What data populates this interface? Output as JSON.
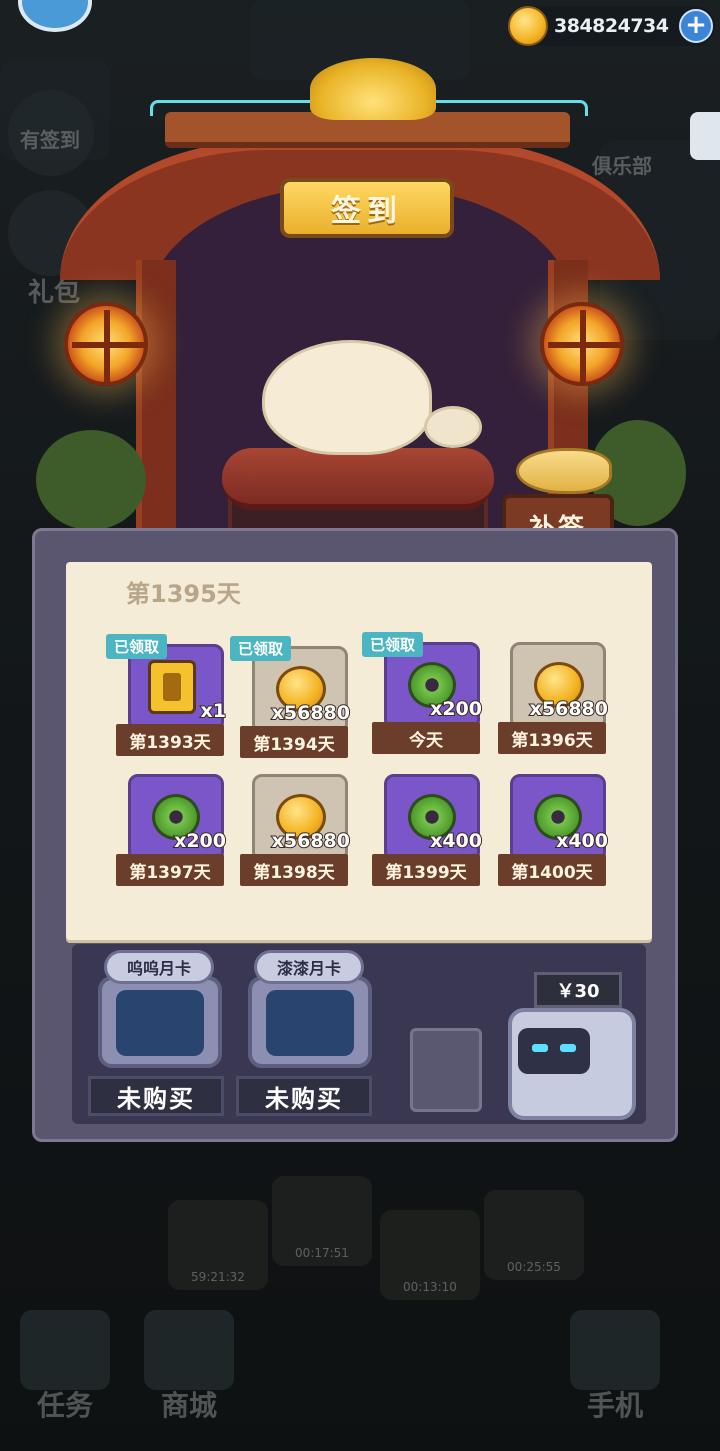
{
  "top_bar": {
    "coins": "384824734",
    "plus_symbol": "+"
  },
  "background": {
    "left_labels": [
      "有签到",
      "礼包"
    ],
    "right_label": "俱乐部"
  },
  "shrine": {
    "sign": "签到",
    "makeup_button": "补签"
  },
  "checkin": {
    "current_day": "第1395天",
    "claimed_label": "已领取",
    "rewards": [
      {
        "day": "第1393天",
        "item": "battery-icon",
        "qty": "x1",
        "claimed": true,
        "bg": "purple"
      },
      {
        "day": "第1394天",
        "item": "coin-icon",
        "qty": "x56880",
        "claimed": true,
        "bg": "paper"
      },
      {
        "day": "今天",
        "item": "donut-icon",
        "qty": "x200",
        "claimed": true,
        "bg": "purple"
      },
      {
        "day": "第1396天",
        "item": "coin-icon",
        "qty": "x56880",
        "claimed": false,
        "bg": "paper"
      },
      {
        "day": "第1397天",
        "item": "donut-icon",
        "qty": "x200",
        "claimed": false,
        "bg": "purple"
      },
      {
        "day": "第1398天",
        "item": "coin-icon",
        "qty": "x56880",
        "claimed": false,
        "bg": "paper"
      },
      {
        "day": "第1399天",
        "item": "donut-icon",
        "qty": "x400",
        "claimed": false,
        "bg": "purple"
      },
      {
        "day": "第1400天",
        "item": "donut-icon",
        "qty": "x400",
        "claimed": false,
        "bg": "purple"
      }
    ]
  },
  "monthly_cards": [
    {
      "name": "呜呜月卡",
      "status": "未购买"
    },
    {
      "name": "漆漆月卡",
      "status": "未购买"
    }
  ],
  "vending": {
    "price": "￥30"
  },
  "timers": [
    "59:21:32",
    "00:17:51",
    "00:13:10",
    "00:25:55"
  ],
  "nav": {
    "tasks": "任务",
    "shop": "商城",
    "phone": "手机"
  }
}
